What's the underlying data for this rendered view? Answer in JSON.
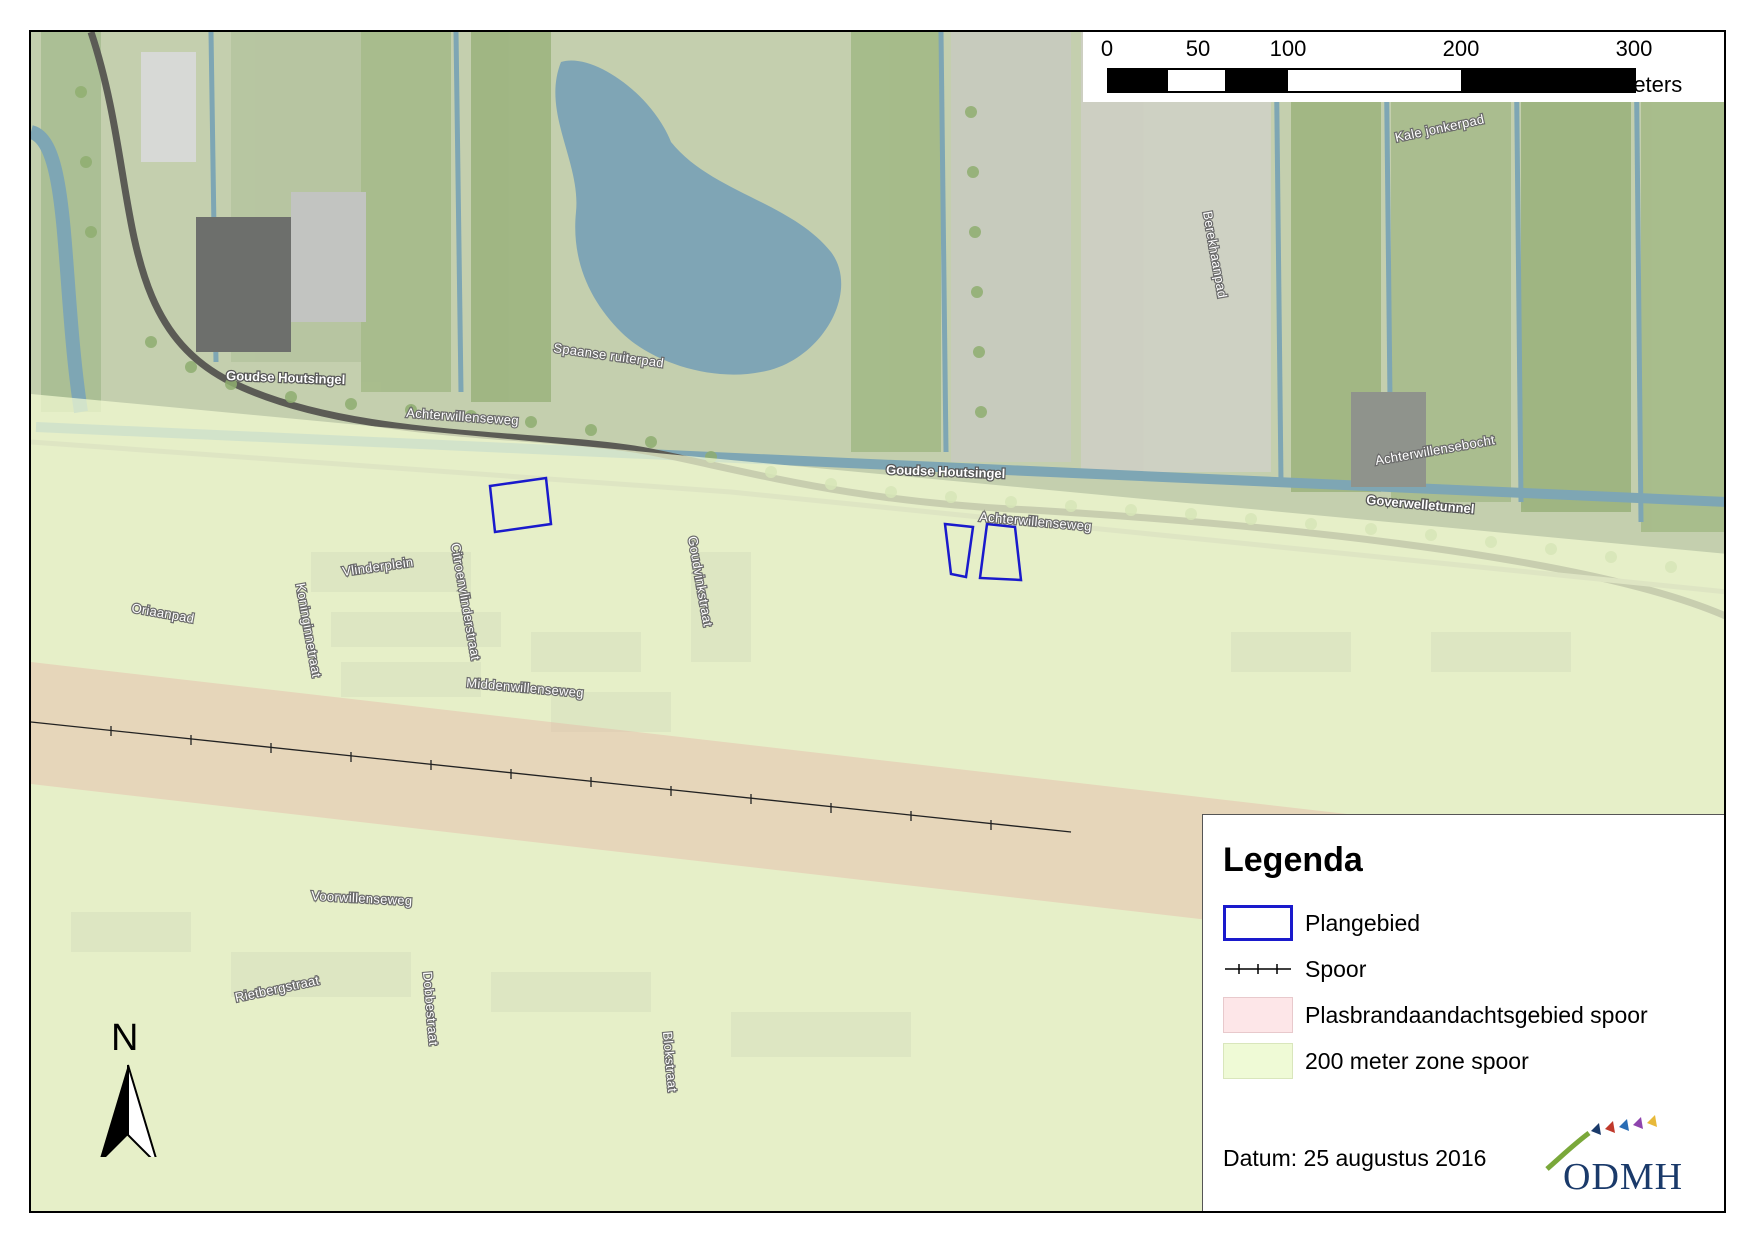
{
  "scale_bar": {
    "tick_labels": [
      "0",
      "50",
      "100",
      "200",
      "300"
    ],
    "ticks": [
      0,
      50,
      100,
      200,
      300
    ],
    "unit": "Meters"
  },
  "north": "N",
  "street_labels": {
    "goudse_houtsingel_1": "Goudse Houtsingel",
    "goudse_houtsingel_2": "Goudse Houtsingel",
    "achterwillenseweg_1": "Achterwillenseweg",
    "achterwillenseweg_2": "Achterwillenseweg",
    "achterwillensebocht": "Achterwillensebocht",
    "goverwelletunnel": "Goverwelletunnel",
    "kale_jonkerpad": "Kale jonkerpad",
    "berkelhaanpad": "Berekhaanpad",
    "spaanse_ruiterpad": "Spaanse ruiterpad",
    "vlinderplein": "Vlinderplein",
    "koninginnestraat": "Koninginnetraat",
    "citroenvlinderstraat": "Citroenvlinderstraat",
    "goudvinkstraat": "Goudvinkstraat",
    "middenwillenseweg": "Middenwillenseweg",
    "voorwillenseweg": "Voorwillenseweg",
    "rietbergstraat": "Rietbergstraat",
    "dobbestraat": "Dobbestraat",
    "blokstraat": "Blokstraat",
    "oriaanstraat": "Oriaanpad"
  },
  "legend": {
    "title": "Legenda",
    "items": [
      {
        "label": "Plangebied",
        "color": "#1a1acc"
      },
      {
        "label": "Spoor",
        "color": "#000000"
      },
      {
        "label": "Plasbrandaandachtsgebied spoor",
        "color": "#fde6e8"
      },
      {
        "label": "200 meter zone spoor",
        "color": "#effad6"
      }
    ],
    "date": "Datum: 25 augustus 2016",
    "logo_text": "ODMH"
  }
}
